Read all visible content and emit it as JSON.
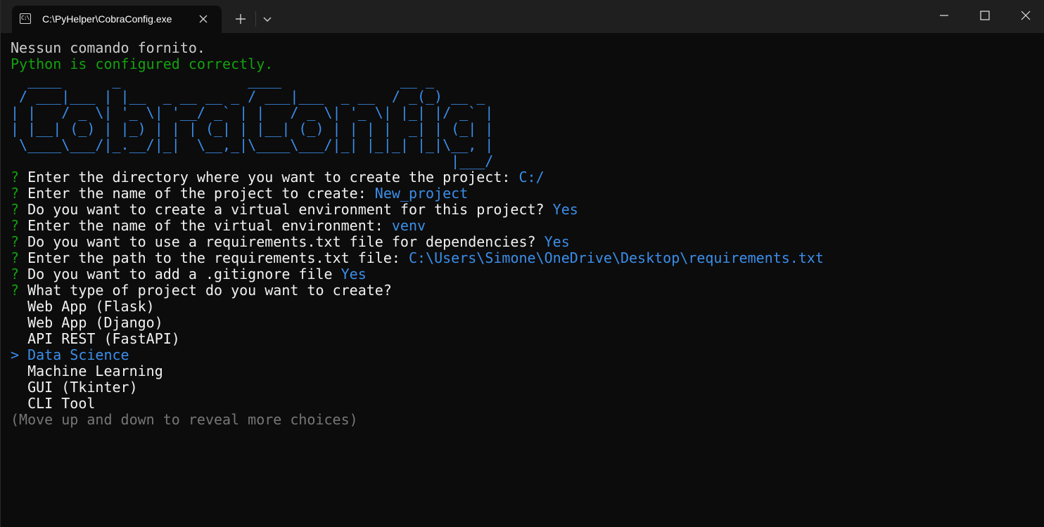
{
  "window": {
    "tab_icon_text": "C:\\",
    "tab_title": "C:\\PyHelper\\CobraConfig.exe",
    "icons": {
      "tab_icon": "terminal-icon",
      "close_tab": "close-icon",
      "new_tab": "plus-icon",
      "dropdown": "chevron-down-icon",
      "minimize": "minimize-icon",
      "maximize": "maximize-icon",
      "close_window": "close-icon"
    }
  },
  "colors": {
    "background": "#0c0c0c",
    "titlebar": "#1f1f1f",
    "text": "#cccccc",
    "green": "#13a10e",
    "blue": "#3b8eea",
    "dim": "#767676"
  },
  "terminal": {
    "status_lines": [
      "Nessun comando fornito.",
      "Python is configured correctly."
    ],
    "ascii_art": [
      "  ____      _               ____              __ _",
      " / ___|___ | |__  _ __ __ _ / ___|___  _ __  / _(_) __ _",
      "| |   / _ \\| '_ \\| '__/ _` | |   / _ \\| '_ \\| |_| |/ _` |",
      "| |__| (_) | |_) | | | (_| | |__| (_) | | | |  _| | (_| |",
      " \\____\\___/|_.__/|_|  \\__,_|\\____\\___/|_| |_|_| |_|\\__, |",
      "                                                    |___/"
    ],
    "prompts": [
      {
        "marker": "?",
        "question": "Enter the directory where you want to create the project:",
        "answer": "C:/"
      },
      {
        "marker": "?",
        "question": "Enter the name of the project to create:",
        "answer": "New_project"
      },
      {
        "marker": "?",
        "question": "Do you want to create a virtual environment for this project?",
        "answer": "Yes"
      },
      {
        "marker": "?",
        "question": "Enter the name of the virtual environment:",
        "answer": "venv"
      },
      {
        "marker": "?",
        "question": "Do you want to use a requirements.txt file for dependencies?",
        "answer": "Yes"
      },
      {
        "marker": "?",
        "question": "Enter the path to the requirements.txt file:",
        "answer": "C:\\Users\\Simone\\OneDrive\\Desktop\\requirements.txt"
      },
      {
        "marker": "?",
        "question": "Do you want to add a .gitignore file",
        "answer": "Yes"
      },
      {
        "marker": "?",
        "question": "What type of project do you want to create?",
        "answer": ""
      }
    ],
    "choices": [
      {
        "label": "Web App (Flask)",
        "selected": false
      },
      {
        "label": "Web App (Django)",
        "selected": false
      },
      {
        "label": "API REST (FastAPI)",
        "selected": false
      },
      {
        "label": "Data Science",
        "selected": true
      },
      {
        "label": "Machine Learning",
        "selected": false
      },
      {
        "label": "GUI (Tkinter)",
        "selected": false
      },
      {
        "label": "CLI Tool",
        "selected": false
      }
    ],
    "selection_pointer": ">",
    "hint": "(Move up and down to reveal more choices)"
  }
}
